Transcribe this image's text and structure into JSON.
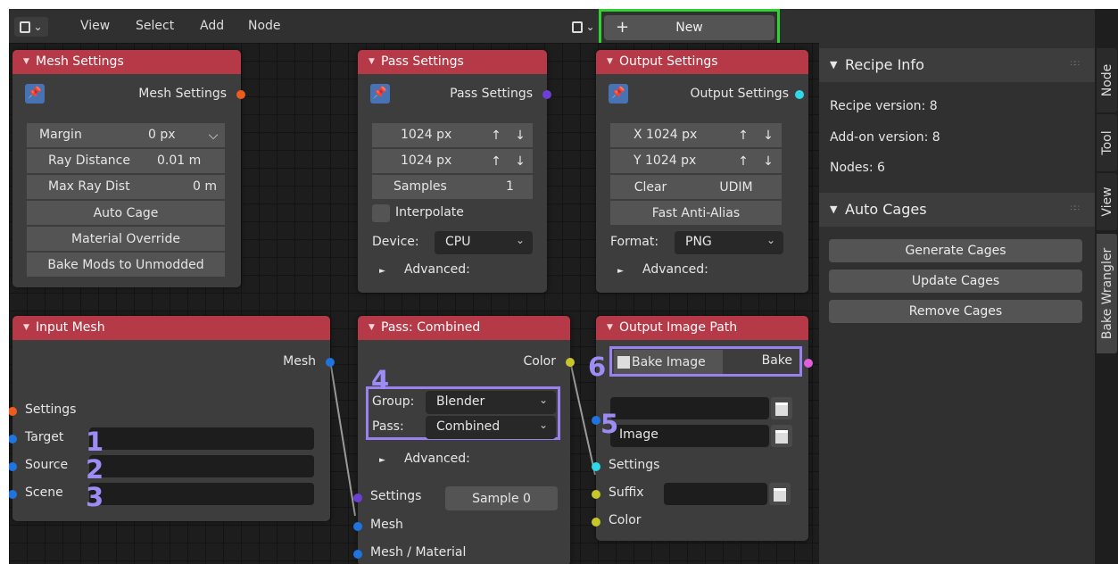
{
  "header": {
    "menu": [
      "View",
      "Select",
      "Add",
      "Node"
    ],
    "new_button": {
      "icon": "+",
      "label": "New"
    }
  },
  "nodes": {
    "mesh_settings": {
      "title": "Mesh Settings",
      "output": "Mesh Settings",
      "margin_label": "Margin",
      "margin_value": "0 px",
      "ray_distance": "Ray Distance",
      "ray_distance_value": "0.01 m",
      "max_ray_dist": "Max Ray Dist",
      "max_ray_dist_value": "0 m",
      "auto_cage": "Auto Cage",
      "material_override": "Material Override",
      "bake_mods": "Bake Mods to Unmodded"
    },
    "pass_settings": {
      "title": "Pass Settings",
      "output": "Pass Settings",
      "width": "1024 px",
      "height": "1024 px",
      "samples_label": "Samples",
      "samples_value": "1",
      "interpolate": "Interpolate",
      "device_label": "Device:",
      "device_value": "CPU",
      "advanced": "Advanced:",
      "up_arrow": "↑",
      "down_arrow": "↓"
    },
    "output_settings": {
      "title": "Output Settings",
      "output": "Output Settings",
      "x": "X 1024 px",
      "y": "Y 1024 px",
      "clear": "Clear",
      "udim": "UDIM",
      "fast_aa": "Fast Anti-Alias",
      "format_label": "Format:",
      "format_value": "PNG",
      "advanced": "Advanced:"
    },
    "input_mesh": {
      "title": "Input Mesh",
      "output": "Mesh",
      "settings": "Settings",
      "target": "Target",
      "source": "Source",
      "scene": "Scene"
    },
    "pass_combined": {
      "title": "Pass: Combined",
      "output": "Color",
      "group_label": "Group:",
      "group_value": "Blender",
      "pass_label": "Pass:",
      "pass_value": "Combined",
      "advanced": "Advanced:",
      "settings": "Settings",
      "sample": "Sample 0",
      "mesh": "Mesh",
      "mesh_material": "Mesh / Material"
    },
    "output_image_path": {
      "title": "Output Image Path",
      "bake_image": "Bake Image",
      "bake_output": "Bake",
      "image_field": "Image",
      "settings": "Settings",
      "suffix": "Suffix",
      "color": "Color"
    }
  },
  "annotations": [
    "1",
    "2",
    "3",
    "4",
    "5",
    "6"
  ],
  "sidebar": {
    "recipe_info": {
      "title": "Recipe Info",
      "recipe_version": "Recipe version: 8",
      "addon_version": "Add-on version: 8",
      "nodes": "Nodes: 6"
    },
    "auto_cages": {
      "title": "Auto Cages",
      "generate": "Generate Cages",
      "update": "Update Cages",
      "remove": "Remove Cages"
    },
    "tabs": [
      "Node",
      "Tool",
      "View",
      "Bake Wrangler"
    ]
  },
  "colors": {
    "node_header": "#b53947",
    "highlight_green": "#2fd22f",
    "annotation_purple": "#9a81f0",
    "socket_orange": "#ed5c1e",
    "socket_purple": "#6c3fd6",
    "socket_cyan": "#2fd8e6",
    "socket_blue": "#1f74e0",
    "socket_yellow": "#c7c729",
    "socket_pink": "#e05fde"
  }
}
